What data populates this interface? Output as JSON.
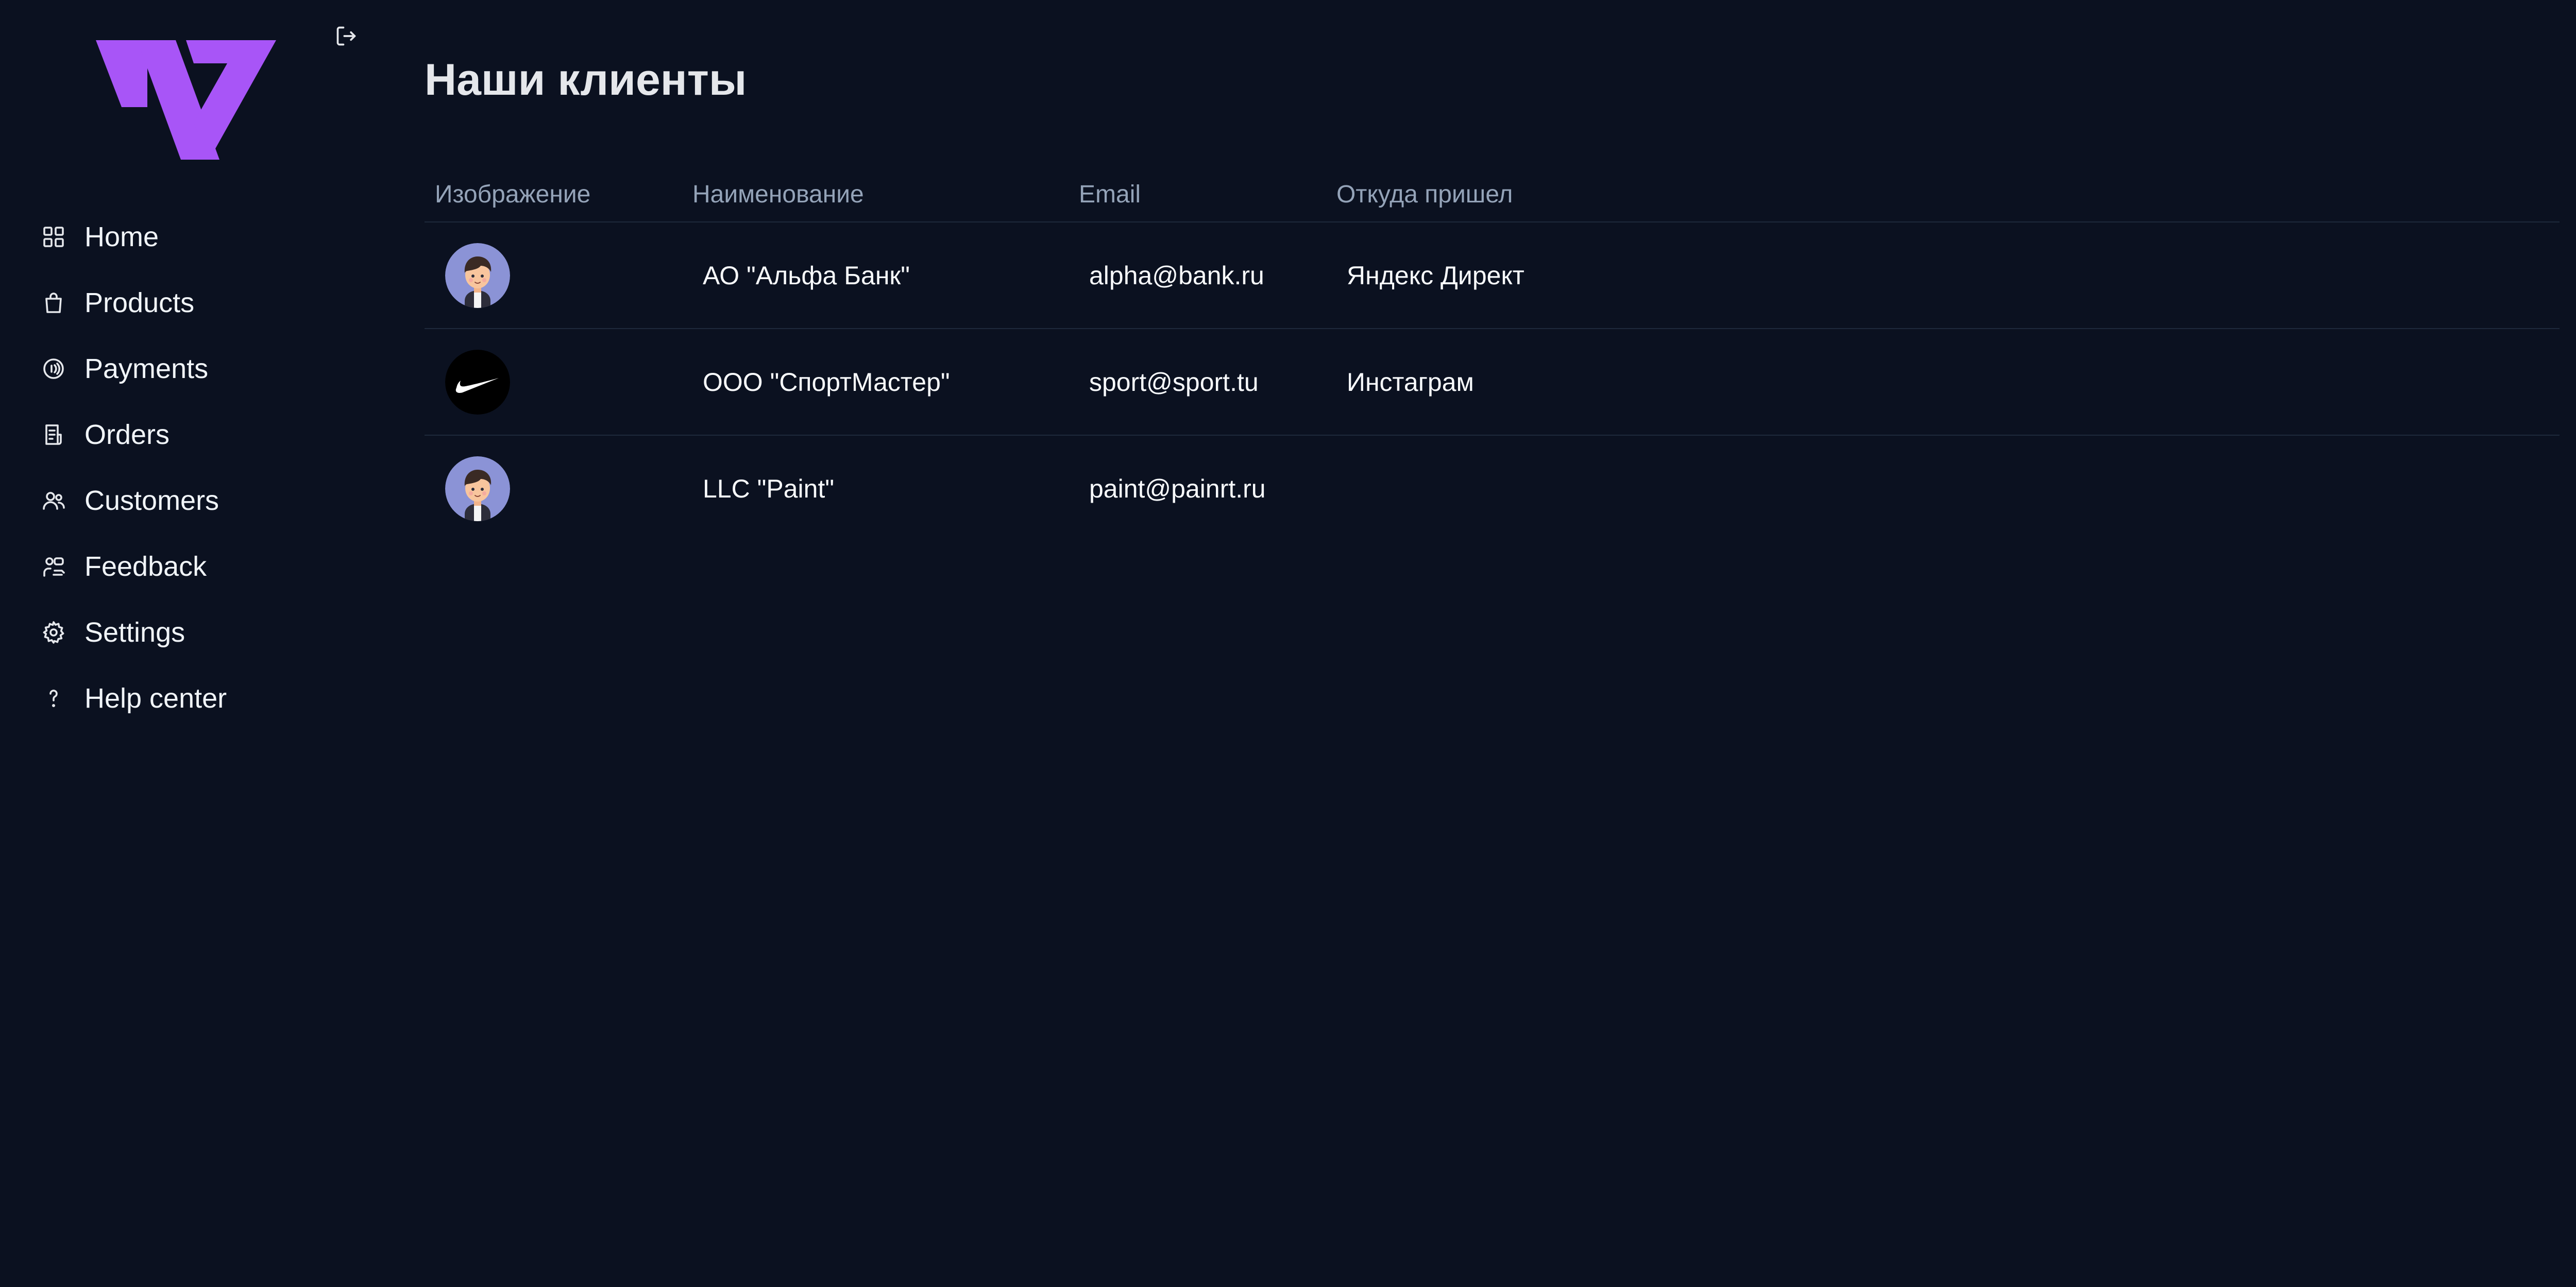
{
  "colors": {
    "background": "#0b1120",
    "brand": "#a855f7",
    "text": "#f1f5f9",
    "muted": "#94a3b8",
    "divider": "#1e293b"
  },
  "sidebar": {
    "logo_icon": "brand-logo",
    "logout_icon": "logout-icon",
    "items": [
      {
        "label": "Home",
        "icon": "grid-icon"
      },
      {
        "label": "Products",
        "icon": "shopping-bag-icon"
      },
      {
        "label": "Payments",
        "icon": "payment-icon"
      },
      {
        "label": "Orders",
        "icon": "receipt-icon"
      },
      {
        "label": "Customers",
        "icon": "users-icon"
      },
      {
        "label": "Feedback",
        "icon": "feedback-icon"
      },
      {
        "label": "Settings",
        "icon": "gear-icon"
      },
      {
        "label": "Help center",
        "icon": "question-icon"
      }
    ]
  },
  "main": {
    "title": "Наши клиенты",
    "table": {
      "columns": [
        "Изображение",
        "Наименование",
        "Email",
        "Откуда пришел"
      ],
      "rows": [
        {
          "avatar": "avatar-boy-icon",
          "name": "АО \"Альфа Банк\"",
          "email": "alpha@bank.ru",
          "source": "Яндекс Директ"
        },
        {
          "avatar": "nike-logo-icon",
          "name": "ООО \"СпортМастер\"",
          "email": "sport@sport.tu",
          "source": "Инстаграм"
        },
        {
          "avatar": "avatar-boy-icon",
          "name": "LLC \"Paint\"",
          "email": "paint@painrt.ru",
          "source": ""
        }
      ]
    }
  }
}
